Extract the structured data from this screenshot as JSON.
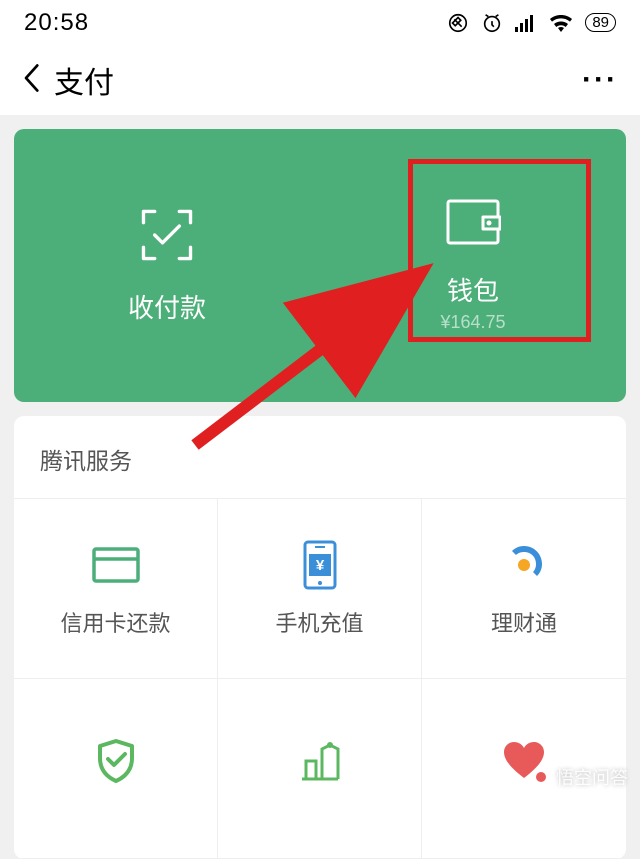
{
  "status": {
    "time": "20:58",
    "battery": "89"
  },
  "nav": {
    "title": "支付"
  },
  "card": {
    "pay_label": "收付款",
    "wallet_label": "钱包",
    "wallet_balance": "¥164.75"
  },
  "section": {
    "header": "腾讯服务"
  },
  "services": {
    "credit": "信用卡还款",
    "recharge": "手机充值",
    "wealth": "理财通"
  },
  "watermark": "悟空问答"
}
